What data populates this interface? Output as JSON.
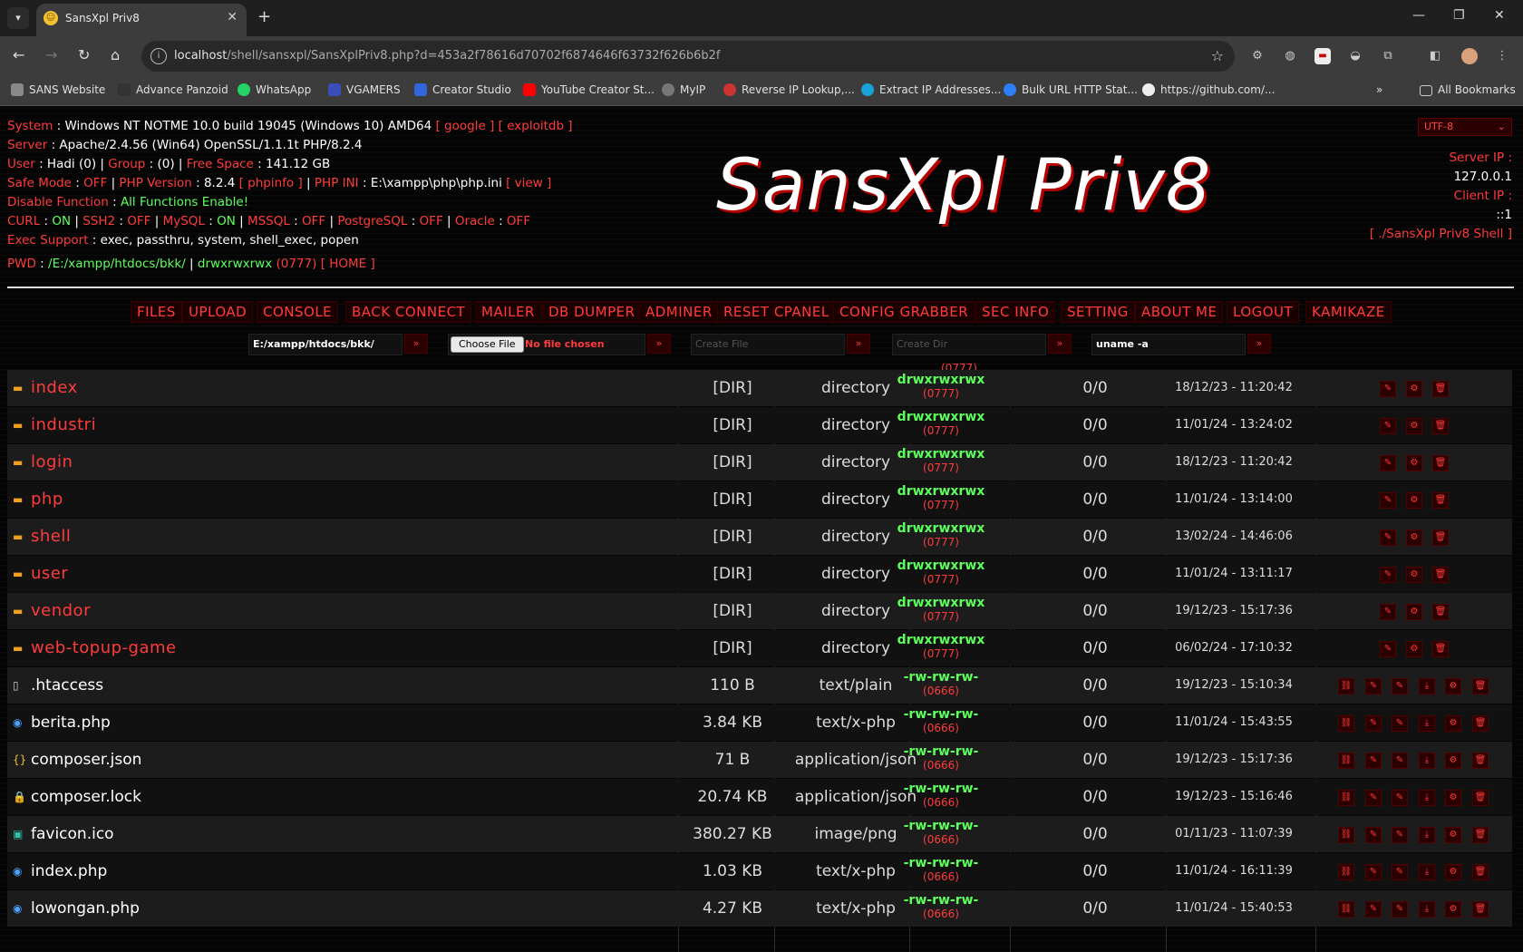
{
  "browser": {
    "tab_title": "SansXpl Priv8",
    "url_host": "localhost",
    "url_path": "/shell/sansxpl/SansXplPriv8.php?d=453a2f78616d70702f6874646f63732f626b6b2f",
    "bookmarks": [
      "SANS Website",
      "Advance Panzoid",
      "WhatsApp",
      "VGAMERS",
      "Creator Studio",
      "YouTube Creator St...",
      "MyIP",
      "Reverse IP Lookup,...",
      "Extract IP Addresses...",
      "Bulk URL HTTP Stat...",
      "https://github.com/..."
    ],
    "all_bookmarks": "All Bookmarks"
  },
  "info": {
    "system_label": "System",
    "system_value": "Windows NT NOTME 10.0 build 19045 (Windows 10) AMD64",
    "google_link": "[ google ]",
    "exploitdb_link": "[ exploitdb ]",
    "server_label": "Server",
    "server_value": "Apache/2.4.56 (Win64) OpenSSL/1.1.1t PHP/8.2.4",
    "user_label": "User",
    "user_value": "Hadi (0)",
    "group_label": "Group",
    "group_value": "(0)",
    "free_label": "Free Space",
    "free_value": "141.12 GB",
    "safe_label": "Safe Mode",
    "safe_value": "OFF",
    "php_label": "PHP Version",
    "php_value": "8.2.4",
    "phpinfo_link": "[ phpinfo ]",
    "phpini_label": "PHP INI",
    "phpini_value": "E:\\xampp\\php\\php.ini",
    "view_link": "[ view ]",
    "disable_label": "Disable Function",
    "disable_value": "All Functions Enable!",
    "curl_label": "CURL",
    "curl_value": "ON",
    "ssh2_label": "SSH2",
    "ssh2_value": "OFF",
    "mysql_label": "MySQL",
    "mysql_value": "ON",
    "mssql_label": "MSSQL",
    "mssql_value": "OFF",
    "pgsql_label": "PostgreSQL",
    "pgsql_value": "OFF",
    "oracle_label": "Oracle",
    "oracle_value": "OFF",
    "exec_label": "Exec Support",
    "exec_value": "exec, passthru, system, shell_exec, popen",
    "pwd_label": "PWD",
    "pwd_value": "/E:/xampp/htdocs/bkk/",
    "pwd_perm": "drwxrwxrwx",
    "pwd_octal": "(0777)",
    "home_link": "[ HOME ]"
  },
  "charset": "UTF-8",
  "logo_text": "SansXpl Priv8",
  "server_ip_label": "Server IP :",
  "server_ip": "127.0.0.1",
  "client_ip_label": "Client IP :",
  "client_ip": "::1",
  "shell_link": "[ ./SansXpl Priv8 Shell ]",
  "menu": [
    "FILES",
    "UPLOAD",
    "CONSOLE",
    "BACK CONNECT",
    "MAILER",
    "DB DUMPER",
    "ADMINER",
    "RESET CPANEL",
    "CONFIG GRABBER",
    "SEC INFO",
    "SETTING",
    "ABOUT ME",
    "LOGOUT",
    "KAMIKAZE"
  ],
  "forms": {
    "path_value": "E:/xampp/htdocs/bkk/",
    "choose_file": "Choose File",
    "no_file": "No file chosen",
    "create_file_placeholder": "Create File",
    "create_dir_placeholder": "Create Dir",
    "cmd_value": "uname -a",
    "go": "»"
  },
  "colors": {
    "accent_red": "#ff3b3b",
    "accent_green": "#5cff5c"
  },
  "files": [
    {
      "name": "index",
      "size": "[DIR]",
      "type": "directory",
      "perm": "drwxrwxrwx",
      "octal": "(0777)",
      "owner": "0/0",
      "date": "18/12/23 - 11:20:42",
      "kind": "dir"
    },
    {
      "name": "industri",
      "size": "[DIR]",
      "type": "directory",
      "perm": "drwxrwxrwx",
      "octal": "(0777)",
      "owner": "0/0",
      "date": "11/01/24 - 13:24:02",
      "kind": "dir"
    },
    {
      "name": "login",
      "size": "[DIR]",
      "type": "directory",
      "perm": "drwxrwxrwx",
      "octal": "(0777)",
      "owner": "0/0",
      "date": "18/12/23 - 11:20:42",
      "kind": "dir"
    },
    {
      "name": "php",
      "size": "[DIR]",
      "type": "directory",
      "perm": "drwxrwxrwx",
      "octal": "(0777)",
      "owner": "0/0",
      "date": "11/01/24 - 13:14:00",
      "kind": "dir"
    },
    {
      "name": "shell",
      "size": "[DIR]",
      "type": "directory",
      "perm": "drwxrwxrwx",
      "octal": "(0777)",
      "owner": "0/0",
      "date": "13/02/24 - 14:46:06",
      "kind": "dir"
    },
    {
      "name": "user",
      "size": "[DIR]",
      "type": "directory",
      "perm": "drwxrwxrwx",
      "octal": "(0777)",
      "owner": "0/0",
      "date": "11/01/24 - 13:11:17",
      "kind": "dir"
    },
    {
      "name": "vendor",
      "size": "[DIR]",
      "type": "directory",
      "perm": "drwxrwxrwx",
      "octal": "(0777)",
      "owner": "0/0",
      "date": "19/12/23 - 15:17:36",
      "kind": "dir"
    },
    {
      "name": "web-topup-game",
      "size": "[DIR]",
      "type": "directory",
      "perm": "drwxrwxrwx",
      "octal": "(0777)",
      "owner": "0/0",
      "date": "06/02/24 - 17:10:32",
      "kind": "dir"
    },
    {
      "name": ".htaccess",
      "size": "110 B",
      "type": "text/plain",
      "perm": "-rw-rw-rw-",
      "octal": "(0666)",
      "owner": "0/0",
      "date": "19/12/23 - 15:10:34",
      "kind": "file"
    },
    {
      "name": "berita.php",
      "size": "3.84 KB",
      "type": "text/x-php",
      "perm": "-rw-rw-rw-",
      "octal": "(0666)",
      "owner": "0/0",
      "date": "11/01/24 - 15:43:55",
      "kind": "php"
    },
    {
      "name": "composer.json",
      "size": "71 B",
      "type": "application/json",
      "perm": "-rw-rw-rw-",
      "octal": "(0666)",
      "owner": "0/0",
      "date": "19/12/23 - 15:17:36",
      "kind": "json"
    },
    {
      "name": "composer.lock",
      "size": "20.74 KB",
      "type": "application/json",
      "perm": "-rw-rw-rw-",
      "octal": "(0666)",
      "owner": "0/0",
      "date": "19/12/23 - 15:16:46",
      "kind": "lock"
    },
    {
      "name": "favicon.ico",
      "size": "380.27 KB",
      "type": "image/png",
      "perm": "-rw-rw-rw-",
      "octal": "(0666)",
      "owner": "0/0",
      "date": "01/11/23 - 11:07:39",
      "kind": "image"
    },
    {
      "name": "index.php",
      "size": "1.03 KB",
      "type": "text/x-php",
      "perm": "-rw-rw-rw-",
      "octal": "(0666)",
      "owner": "0/0",
      "date": "11/01/24 - 16:11:39",
      "kind": "php"
    },
    {
      "name": "lowongan.php",
      "size": "4.27 KB",
      "type": "text/x-php",
      "perm": "-rw-rw-rw-",
      "octal": "(0666)",
      "owner": "0/0",
      "date": "11/01/24 - 15:40:53",
      "kind": "php"
    }
  ],
  "partial_row_octal": "(0777)"
}
